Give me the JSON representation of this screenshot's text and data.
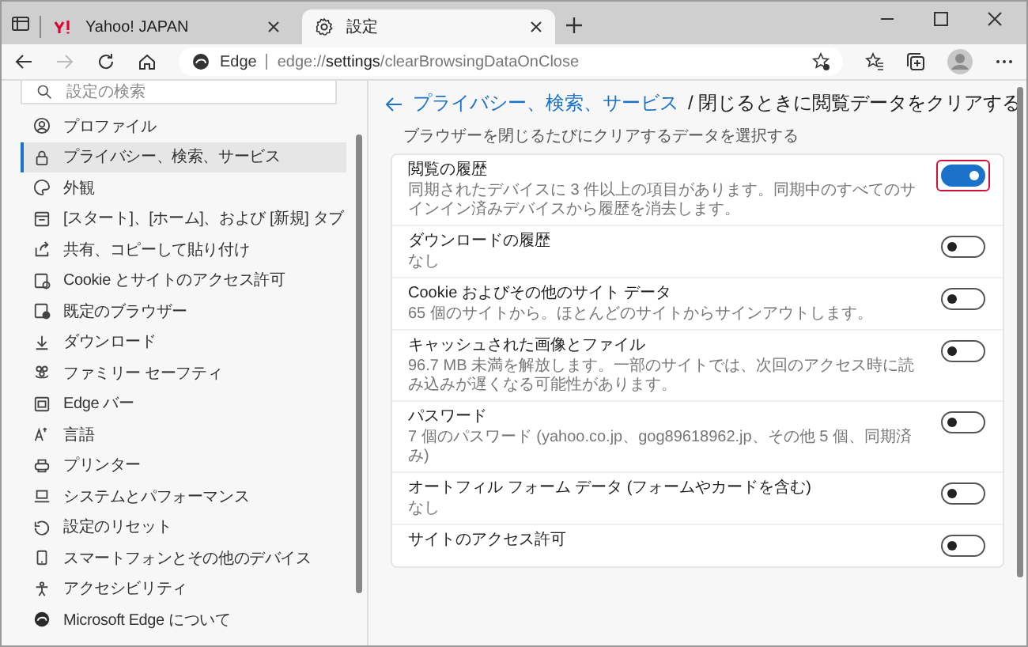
{
  "tabs": [
    {
      "title": "Yahoo! JAPAN",
      "selected": false
    },
    {
      "title": "設定",
      "selected": true
    }
  ],
  "toolbar": {
    "forward_disabled": true,
    "site_label": "Edge",
    "url": "edge://**settings**/clearBrowsingDataOnClose"
  },
  "sidebar": {
    "search_placeholder": "設定の検索",
    "items": [
      {
        "label": "プロファイル",
        "selected": false
      },
      {
        "label": "プライバシー、検索、サービス",
        "selected": true
      },
      {
        "label": "外観",
        "selected": false
      },
      {
        "label": "[スタート]、[ホーム]、および [新規] タブ",
        "selected": false
      },
      {
        "label": "共有、コピーして貼り付け",
        "selected": false
      },
      {
        "label": "Cookie とサイトのアクセス許可",
        "selected": false
      },
      {
        "label": "既定のブラウザー",
        "selected": false
      },
      {
        "label": "ダウンロード",
        "selected": false
      },
      {
        "label": "ファミリー セーフティ",
        "selected": false
      },
      {
        "label": "Edge バー",
        "selected": false
      },
      {
        "label": "言語",
        "selected": false
      },
      {
        "label": "プリンター",
        "selected": false
      },
      {
        "label": "システムとパフォーマンス",
        "selected": false
      },
      {
        "label": "設定のリセット",
        "selected": false
      },
      {
        "label": "スマートフォンとその他のデバイス",
        "selected": false
      },
      {
        "label": "アクセシビリティ",
        "selected": false
      },
      {
        "label": "Microsoft Edge について",
        "selected": false
      }
    ]
  },
  "main": {
    "breadcrumb_link": "プライバシー、検索、サービス",
    "title": "/ 閉じるときに閲覧データをクリアする",
    "subtitle": "ブラウザーを閉じるたびにクリアするデータを選択する",
    "rows": [
      {
        "title": "閲覧の履歴",
        "description": "同期されたデバイスに 3 件以上の項目があります。同期中のすべてのサインイン済みデバイスから履歴を消去します。",
        "on": true,
        "highlighted": true
      },
      {
        "title": "ダウンロードの履歴",
        "description": "なし",
        "on": false,
        "highlighted": false
      },
      {
        "title": "Cookie およびその他のサイト データ",
        "description": "65 個のサイトから。ほとんどのサイトからサインアウトします。",
        "on": false,
        "highlighted": false
      },
      {
        "title": "キャッシュされた画像とファイル",
        "description": "96.7 MB 未満を解放します。一部のサイトでは、次回のアクセス時に読み込みが遅くなる可能性があります。",
        "on": false,
        "highlighted": false
      },
      {
        "title": "パスワード",
        "description": "7 個のパスワード (yahoo.co.jp、gog89618962.jp、その他 5 個、同期済み)",
        "on": false,
        "highlighted": false
      },
      {
        "title": "オートフィル フォーム データ (フォームやカードを含む)",
        "description": "なし",
        "on": false,
        "highlighted": false
      },
      {
        "title": "サイトのアクセス許可",
        "on": false,
        "highlighted": false
      }
    ]
  }
}
